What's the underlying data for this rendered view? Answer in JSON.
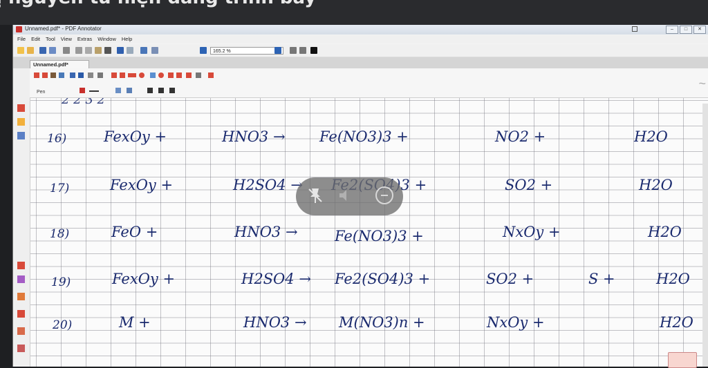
{
  "top_caption": "ị nguyên tử hiện đang trình bày",
  "window": {
    "title": "Unnamed.pdf* - PDF Annotator"
  },
  "menu": [
    "File",
    "Edit",
    "Tool",
    "View",
    "Extras",
    "Window",
    "Help"
  ],
  "toolbar": {
    "zoom_value": "165.2 %"
  },
  "document_tab": {
    "label": "Unnamed.pdf*"
  },
  "annotation_toolbar": {
    "tool_label": "Pen"
  },
  "handwriting": {
    "top_partial": "2       2  3             2",
    "rows": [
      {
        "number": "16)",
        "reactant1": "FexOy +",
        "reactant2": "HNO3 →",
        "product1": "Fe(NO3)3 +",
        "product2": "NO2 +",
        "product3": "",
        "product4": "H2O"
      },
      {
        "number": "17)",
        "reactant1": "FexOy +",
        "reactant2": "H2SO4 →",
        "product1": "Fe2(SO4)3 +",
        "product2": "SO2 +",
        "product3": "",
        "product4": "H2O"
      },
      {
        "number": "18)",
        "reactant1": "FeO +",
        "reactant2": "HNO3 →",
        "product1": "Fe(NO3)3 +",
        "product2": "NxOy +",
        "product3": "",
        "product4": "H2O"
      },
      {
        "number": "19)",
        "reactant1": "FexOy +",
        "reactant2": "H2SO4 →",
        "product1": "Fe2(SO4)3 +",
        "product2": "SO2 +",
        "product3": "S +",
        "product4": "H2O"
      },
      {
        "number": "20)",
        "reactant1": "M +",
        "reactant2": "HNO3 →",
        "product1": "M(NO3)n +",
        "product2": "NxOy +",
        "product3": "",
        "product4": "H2O"
      }
    ]
  },
  "colors": {
    "ink": "#1a2a6e",
    "overlay": "#6e6e6e",
    "app_red": "#c8302c",
    "highlight_orange": "#f2a93b"
  }
}
